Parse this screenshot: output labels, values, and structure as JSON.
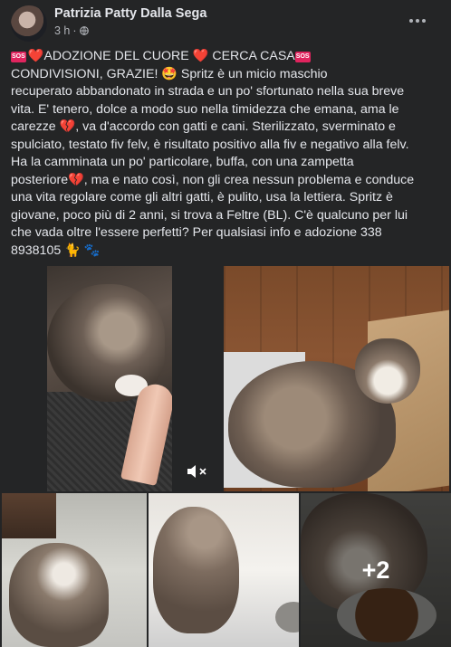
{
  "post": {
    "author": "Patrizia Patty Dalla Sega",
    "time": "3 h",
    "separator": "·",
    "lines": [
      {
        "sos1": "SOS",
        "heart1": "❤️",
        "text1": "ADOZIONE DEL CUORE ",
        "heart2": "❤️",
        "text2": " CERCA CASA",
        "sos2": "SOS"
      },
      {
        "text": "CONDIVISIONI, GRAZIE! 🤩           Spritz è un micio maschio"
      },
      {
        "text": "recuperato abbandonato in strada e un po' sfortunato nella sua breve"
      },
      {
        "text": "vita. E' tenero, dolce a modo suo nella timidezza che emana, ama le"
      },
      {
        "text": "carezze 💔, va d'accordo con gatti e cani. Sterilizzato, sverminato e"
      },
      {
        "text": "spulciato, testato fiv felv, è risultato positivo alla fiv e negativo alla felv."
      },
      {
        "text": "Ha la camminata un po' particolare, buffa, con una zampetta"
      },
      {
        "text": "posteriore💔, ma e nato così, non gli crea nessun problema e conduce"
      },
      {
        "text": "una vita regolare come gli altri gatti, è pulito, usa la lettiera. Spritz è"
      },
      {
        "text": "giovane, poco più di 2 anni, si trova a Feltre (BL). C'è qualcuno per lui"
      },
      {
        "text": "che vada oltre l'essere perfetti? Per qualsiasi info e adozione 338"
      },
      {
        "text": "8938105 🐈 🐾"
      }
    ]
  },
  "media": {
    "more_count": "+2"
  },
  "icons": {
    "more": "more-options-icon",
    "privacy": "globe-icon",
    "mute": "volume-muted-icon"
  }
}
